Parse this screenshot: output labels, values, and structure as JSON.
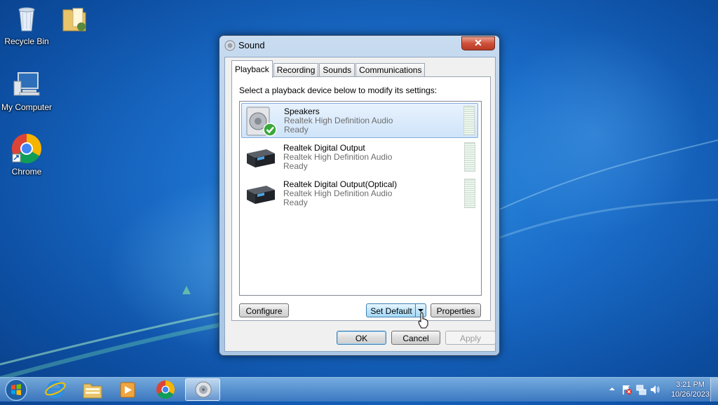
{
  "desktop": {
    "icons": [
      {
        "label": "Recycle Bin",
        "icon": "recycle-bin-icon"
      },
      {
        "label": "",
        "icon": "user-folder-icon"
      },
      {
        "label": "My Computer",
        "icon": "computer-icon"
      },
      {
        "label": "Chrome",
        "icon": "chrome-icon"
      }
    ]
  },
  "dialog": {
    "title": "Sound",
    "close_label": "✕",
    "tabs": [
      {
        "label": "Playback",
        "active": true
      },
      {
        "label": "Recording",
        "active": false
      },
      {
        "label": "Sounds",
        "active": false
      },
      {
        "label": "Communications",
        "active": false
      }
    ],
    "instruction": "Select a playback device below to modify its settings:",
    "devices": [
      {
        "name": "Speakers",
        "driver": "Realtek High Definition Audio",
        "status": "Ready",
        "icon": "speaker-icon",
        "default": true,
        "selected": true
      },
      {
        "name": "Realtek Digital Output",
        "driver": "Realtek High Definition Audio",
        "status": "Ready",
        "icon": "digital-output-icon",
        "default": false,
        "selected": false
      },
      {
        "name": "Realtek Digital Output(Optical)",
        "driver": "Realtek High Definition Audio",
        "status": "Ready",
        "icon": "digital-output-icon",
        "default": false,
        "selected": false
      }
    ],
    "buttons": {
      "configure": "Configure",
      "set_default": "Set Default",
      "properties": "Properties",
      "ok": "OK",
      "cancel": "Cancel",
      "apply": "Apply"
    }
  },
  "taskbar": {
    "items": [
      "start-orb-icon",
      "internet-explorer-icon",
      "windows-explorer-icon",
      "media-player-icon",
      "chrome-icon",
      "sound-icon"
    ],
    "clock_time": "3:21 PM",
    "clock_date": "10/26/2023"
  },
  "colors": {
    "desktop": "#1a6cc8",
    "selection": "#cfe4fa",
    "close_button": "#d0503a"
  }
}
